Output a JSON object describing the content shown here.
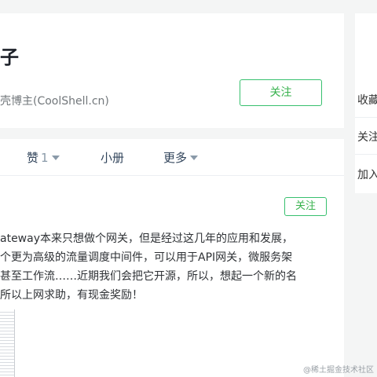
{
  "profile": {
    "name": "子",
    "description": "壳博主(CoolShell.cn)",
    "follow_label": "关注"
  },
  "tabs": [
    {
      "label": "赞",
      "count": "1"
    },
    {
      "label": "小册"
    },
    {
      "label": "更多"
    }
  ],
  "post": {
    "follow_label": "关注",
    "lines": [
      "ateway本来只想做个网关，但是经过这几年的应用和发展，",
      "个更为高级的流量调度中间件，可以用于API网关，微服务架",
      "甚至工作流……近期我们会把它开源，所以，想起一个新的名",
      "所以上网求助，有现金奖励！"
    ]
  },
  "sidebar": {
    "items": [
      {
        "label": "收藏"
      },
      {
        "label": "关注"
      },
      {
        "label": "加入"
      }
    ]
  },
  "watermark": "@稀土掘金技术社区",
  "colors": {
    "accent_green": "#37c06e",
    "page_bg": "#f4f5f5",
    "tab_text": "#31445b"
  },
  "icons": {
    "tab_dropdown": "caret-down-icon"
  }
}
